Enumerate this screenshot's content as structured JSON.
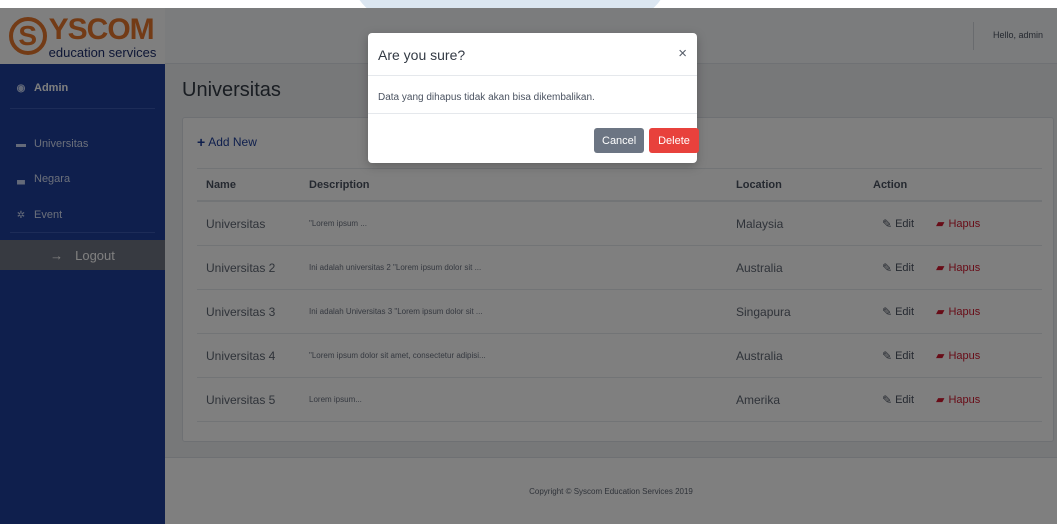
{
  "brand": {
    "logo_letter": "S",
    "logo_main": "YSCOM",
    "logo_sub": "education services"
  },
  "sidebar": {
    "items": [
      {
        "label": "Admin",
        "icon": "dashboard-icon"
      },
      {
        "label": "Universitas",
        "icon": "folder-icon"
      },
      {
        "label": "Negara",
        "icon": "chart-icon"
      },
      {
        "label": "Event",
        "icon": "gear-icon"
      }
    ],
    "logout_label": "Logout"
  },
  "header": {
    "greeting": "Hello, admin"
  },
  "main": {
    "title": "Universitas",
    "add_new_label": "Add New",
    "table": {
      "columns": [
        "Name",
        "Description",
        "Location",
        "Action"
      ],
      "rows": [
        {
          "name": "Universitas",
          "description": "\"Lorem ipsum ...",
          "location": "Malaysia"
        },
        {
          "name": "Universitas 2",
          "description": "Ini adalah universitas 2 \"Lorem ipsum dolor sit ...",
          "location": "Australia"
        },
        {
          "name": "Universitas 3",
          "description": "Ini adalah Universitas 3 \"Lorem ipsum dolor sit ...",
          "location": "Singapura"
        },
        {
          "name": "Universitas 4",
          "description": "\"Lorem ipsum dolor sit amet, consectetur adipisi...",
          "location": "Australia"
        },
        {
          "name": "Universitas 5",
          "description": "Lorem ipsum...",
          "location": "Amerika"
        }
      ],
      "edit_label": "Edit",
      "delete_label": "Hapus"
    }
  },
  "footer": {
    "copyright": "Copyright © Syscom Education Services 2019"
  },
  "modal": {
    "title": "Are you sure?",
    "close_glyph": "×",
    "message": "Data yang dihapus tidak akan bisa dikembalikan.",
    "cancel_label": "Cancel",
    "delete_label": "Delete"
  },
  "colors": {
    "sidebar": "#1e3f9a",
    "accent_orange": "#e6772c",
    "danger": "#e8413c",
    "secondary": "#6c7583",
    "logout_bg": "#6f7583"
  }
}
